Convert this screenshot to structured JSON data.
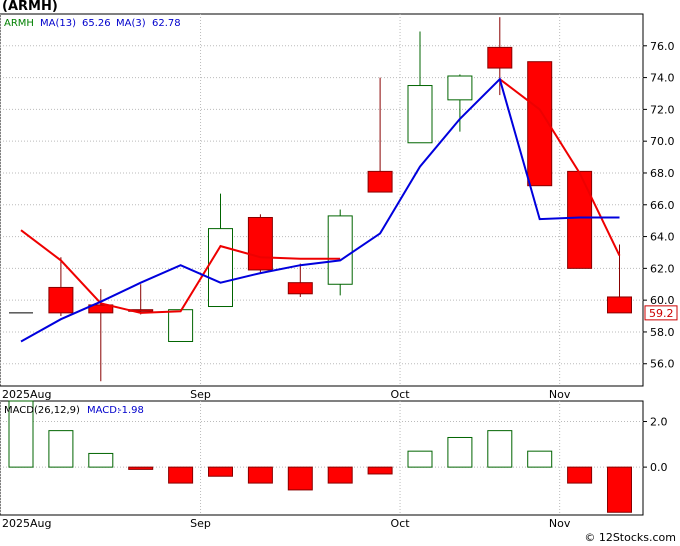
{
  "title": "(ARMH)",
  "credit": "© 12Stocks.com",
  "chart_data": [
    {
      "type": "candlestick",
      "ticker": "ARMH",
      "legend": {
        "ticker": "ARMH",
        "ma13_label": "MA(13)",
        "ma13_value": "65.26",
        "ma3_label": "MA(3)",
        "ma3_value": "62.78"
      },
      "x_labels": [
        {
          "text": "2025Aug",
          "i": 0
        },
        {
          "text": "Sep",
          "i": 4.5
        },
        {
          "text": "Oct",
          "i": 9.5
        },
        {
          "text": "Nov",
          "i": 13.5
        }
      ],
      "y_ticks": [
        56.0,
        58.0,
        60.0,
        62.0,
        64.0,
        66.0,
        68.0,
        70.0,
        72.0,
        74.0,
        76.0
      ],
      "ylim": [
        54.6,
        78.0
      ],
      "last_price": "59.2",
      "candles": [
        {
          "o": 59.2,
          "h": 59.2,
          "l": 59.2,
          "c": 59.2
        },
        {
          "o": 60.8,
          "h": 62.7,
          "l": 59.0,
          "c": 59.2
        },
        {
          "o": 59.7,
          "h": 60.7,
          "l": 54.9,
          "c": 59.2
        },
        {
          "o": 59.4,
          "h": 61.0,
          "l": 59.1,
          "c": 59.3
        },
        {
          "o": 57.4,
          "h": 59.4,
          "l": 57.4,
          "c": 59.4
        },
        {
          "o": 59.6,
          "h": 66.7,
          "l": 59.6,
          "c": 64.5
        },
        {
          "o": 65.2,
          "h": 65.4,
          "l": 61.7,
          "c": 61.9
        },
        {
          "o": 61.1,
          "h": 62.3,
          "l": 60.2,
          "c": 60.4
        },
        {
          "o": 61.0,
          "h": 65.7,
          "l": 60.3,
          "c": 65.3
        },
        {
          "o": 68.1,
          "h": 74.0,
          "l": 66.8,
          "c": 66.8
        },
        {
          "o": 69.9,
          "h": 76.9,
          "l": 69.9,
          "c": 73.5
        },
        {
          "o": 72.6,
          "h": 74.2,
          "l": 70.6,
          "c": 74.1
        },
        {
          "o": 75.9,
          "h": 77.8,
          "l": 72.9,
          "c": 74.6
        },
        {
          "o": 75.0,
          "h": 75.0,
          "l": 67.2,
          "c": 67.2
        },
        {
          "o": 68.1,
          "h": 68.1,
          "l": 62.0,
          "c": 62.0
        },
        {
          "o": 60.2,
          "h": 63.5,
          "l": 59.2,
          "c": 59.2
        }
      ],
      "ma3": [
        64.4,
        62.5,
        59.8,
        59.2,
        59.3,
        63.4,
        62.7,
        62.6,
        62.6,
        null,
        null,
        null,
        73.9,
        72.0,
        68.0,
        62.8
      ],
      "ma13": [
        57.4,
        58.8,
        59.9,
        61.1,
        62.2,
        61.1,
        61.7,
        62.2,
        62.5,
        64.2,
        68.4,
        71.4,
        73.9,
        65.1,
        65.2,
        65.2
      ]
    },
    {
      "type": "bar",
      "name": "MACD",
      "legend": {
        "label": "MACD(26,12,9)",
        "value_label": "MACD:",
        "value": "-1.98"
      },
      "y_ticks": [
        2.0,
        0.0
      ],
      "ylim": [
        -2.1,
        2.9
      ],
      "values": [
        2.9,
        1.6,
        0.6,
        -0.1,
        -0.7,
        -0.4,
        -0.7,
        -1.0,
        -0.7,
        -0.3,
        0.7,
        1.3,
        1.6,
        0.7,
        -0.7,
        -1.98
      ]
    }
  ]
}
